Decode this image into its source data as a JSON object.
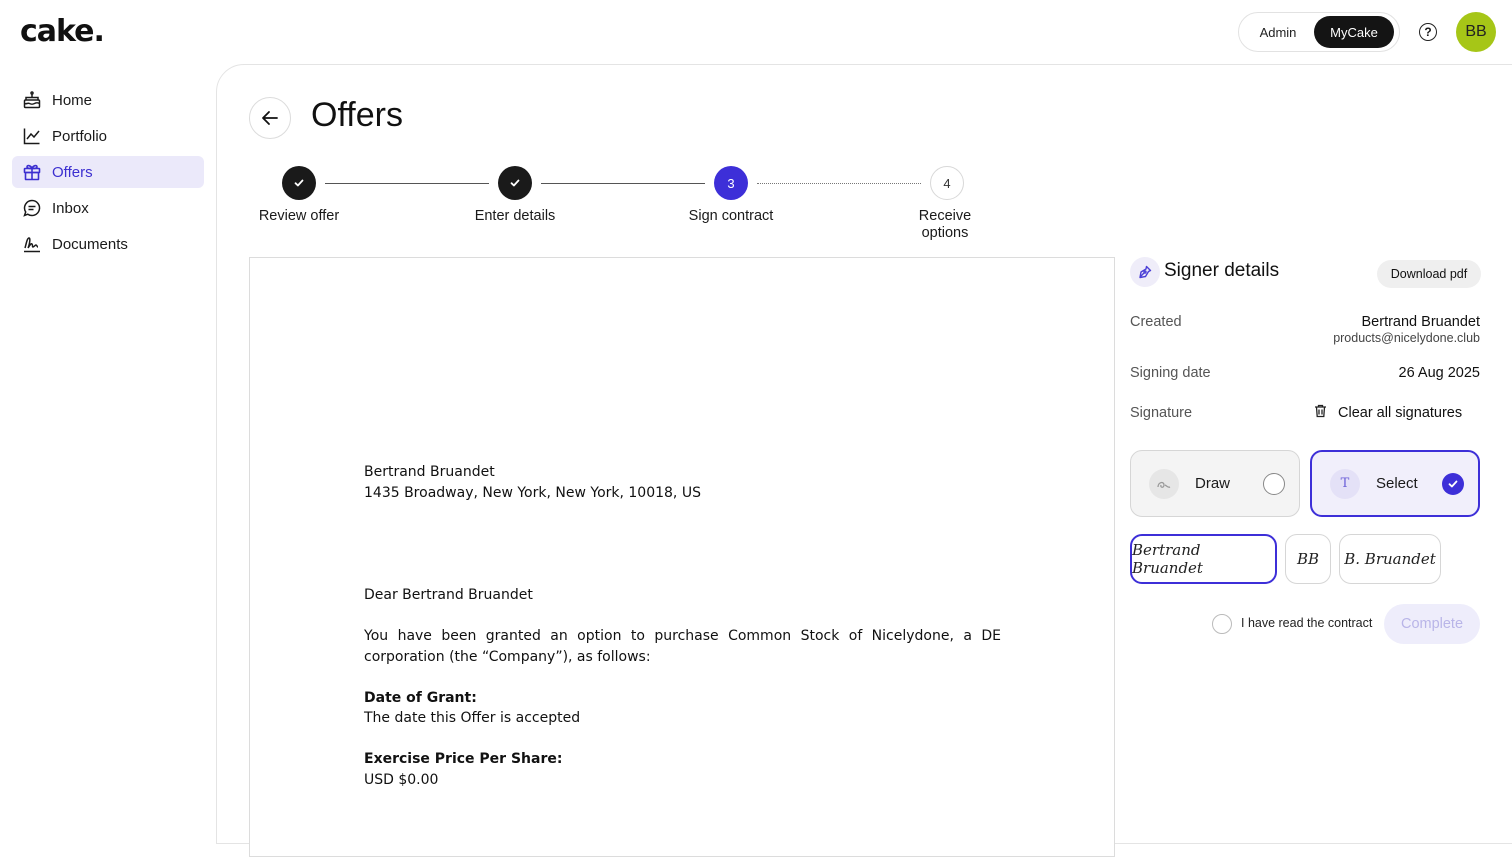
{
  "header": {
    "logo": "cake.",
    "toggle": {
      "admin_label": "Admin",
      "mycake_label": "MyCake"
    },
    "help_icon": "help-icon",
    "avatar_initials": "BB"
  },
  "sidebar": {
    "items": [
      {
        "label": "Home",
        "icon": "home-icon",
        "active": false
      },
      {
        "label": "Portfolio",
        "icon": "chart-icon",
        "active": false
      },
      {
        "label": "Offers",
        "icon": "gift-icon",
        "active": true
      },
      {
        "label": "Inbox",
        "icon": "message-icon",
        "active": false
      },
      {
        "label": "Documents",
        "icon": "signature-icon",
        "active": false
      }
    ]
  },
  "page": {
    "title": "Offers"
  },
  "stepper": {
    "steps": [
      {
        "number": "1",
        "label": "Review offer",
        "state": "done"
      },
      {
        "number": "2",
        "label": "Enter details",
        "state": "done"
      },
      {
        "number": "3",
        "label": "Sign contract",
        "state": "current"
      },
      {
        "number": "4",
        "label_line1": "Receive",
        "label_line2": "options",
        "state": "todo"
      }
    ]
  },
  "document": {
    "name": "Bertrand Bruandet",
    "address": "1435 Broadway, New York, New York, 10018, US",
    "greeting": "Dear Bertrand Bruandet",
    "intro": "You have been granted an option to purchase Common Stock of Nicelydone, a DE corporation (the “Company”), as follows:",
    "grant_date_heading": "Date of Grant:",
    "grant_date_value": "The date this Offer is accepted",
    "exercise_price_heading": "Exercise Price Per Share:",
    "exercise_price_value": "USD $0.00"
  },
  "signer": {
    "title": "Signer details",
    "download_label": "Download pdf",
    "created_label": "Created",
    "created_name": "Bertrand Bruandet",
    "created_email": "products@nicelydone.club",
    "signing_date_label": "Signing date",
    "signing_date_value": "26 Aug 2025",
    "signature_label": "Signature",
    "clear_label": "Clear all signatures",
    "modes": {
      "draw_label": "Draw",
      "select_label": "Select",
      "selected": "Select"
    },
    "signature_options": [
      "Bertrand Bruandet",
      "BB",
      "B. Bruandet"
    ],
    "selected_signature": "Bertrand Bruandet",
    "read_label": "I have read the contract",
    "complete_label": "Complete"
  },
  "colors": {
    "accent": "#3d2fd8",
    "avatar": "#a6c617",
    "active_nav_bg": "#ebe9fa"
  }
}
